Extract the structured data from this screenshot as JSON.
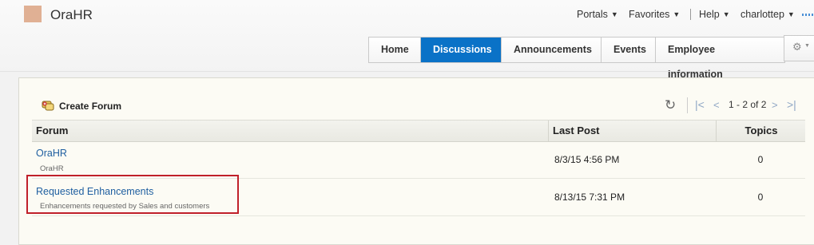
{
  "app": {
    "title": "OraHR",
    "logo_color": "#e0b094"
  },
  "topnav": {
    "portals": "Portals",
    "favorites": "Favorites",
    "help": "Help",
    "user": "charlottep",
    "caret_icon": "triangle-down-icon"
  },
  "tabs": [
    {
      "label": "Home",
      "active": false
    },
    {
      "label": "Discussions",
      "active": true
    },
    {
      "label": "Announcements",
      "active": false
    },
    {
      "label": "Events",
      "active": false
    },
    {
      "label": "Employee Information",
      "active": false
    }
  ],
  "toolbar": {
    "create_forum_label": "Create Forum",
    "pager_text": "1 - 2 of 2"
  },
  "table": {
    "columns": {
      "forum": "Forum",
      "last_post": "Last Post",
      "topics": "Topics"
    },
    "rows": [
      {
        "name": "OraHR",
        "description": "OraHR",
        "last_post": "8/3/15 4:56 PM",
        "topics": "0"
      },
      {
        "name": "Requested Enhancements",
        "description": "Enhancements requested by Sales and customers",
        "last_post": "8/13/15 7:31 PM",
        "topics": "0"
      }
    ]
  },
  "colors": {
    "accent": "#0a72c7",
    "link": "#1f5fa0",
    "highlight": "#c0202a"
  }
}
